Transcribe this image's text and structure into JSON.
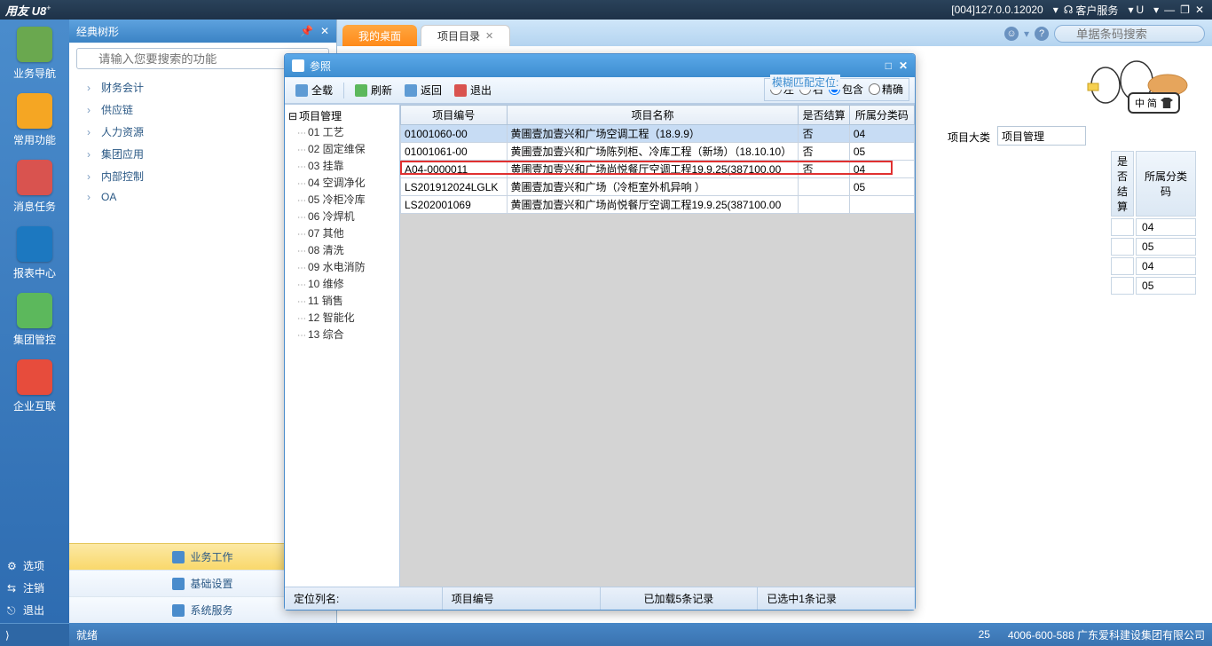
{
  "titlebar": {
    "logo": "用友 U8",
    "sup": "+",
    "server_info": "[004]127.0.0.12020",
    "customer_service": "客户服务",
    "u_label": "U"
  },
  "leftnav": {
    "items": [
      {
        "label": "业务导航",
        "cls": ""
      },
      {
        "label": "常用功能",
        "cls": "orange"
      },
      {
        "label": "消息任务",
        "cls": "red"
      },
      {
        "label": "报表中心",
        "cls": "blue"
      },
      {
        "label": "集团管控",
        "cls": "green2"
      },
      {
        "label": "企业互联",
        "cls": "redpk"
      }
    ],
    "bottom": {
      "options": "选项",
      "logout": "注销",
      "exit": "退出"
    }
  },
  "tree": {
    "title": "经典树形",
    "search_placeholder": "请输入您要搜索的功能",
    "items": [
      "财务会计",
      "供应链",
      "人力资源",
      "集团应用",
      "内部控制",
      "OA"
    ],
    "footer": {
      "biz": "业务工作",
      "basic": "基础设置",
      "sys": "系统服务"
    }
  },
  "tabs": {
    "t1": "我的桌面",
    "t2": "项目目录",
    "search_placeholder": "单据条码搜索"
  },
  "main": {
    "category_label": "项目大类",
    "category_value": "项目管理",
    "doodle_label": "中 简",
    "table": {
      "h1": "是否结算",
      "h2": "所属分类码",
      "rows": [
        "04",
        "05",
        "04",
        "05"
      ]
    }
  },
  "dialog": {
    "title": "参照",
    "toolbar": {
      "full": "全载",
      "refresh": "刷新",
      "back": "返回",
      "exit": "退出"
    },
    "match": {
      "legend": "模糊匹配定位:",
      "left": "左",
      "right": "右",
      "contain": "包含",
      "exact": "精确"
    },
    "tree_root": "项目管理",
    "tree_children": [
      "01 工艺",
      "02 固定维保",
      "03 挂靠",
      "04 空调净化",
      "05 冷柜冷库",
      "06 冷焊机",
      "07 其他",
      "08 清洗",
      "09 水电消防",
      "10 维修",
      "11 销售",
      "12 智能化",
      "13 综合"
    ],
    "grid": {
      "h1": "项目编号",
      "h2": "项目名称",
      "h3": "是否结算",
      "h4": "所属分类码",
      "rows": [
        {
          "c1": "01001060-00",
          "c2": "黄圃壹加壹兴和广场空调工程（18.9.9）",
          "c3": "否",
          "c4": "04"
        },
        {
          "c1": "01001061-00",
          "c2": "黄圃壹加壹兴和广场陈列柜、冷库工程（新场）（18.10.10）",
          "c3": "否",
          "c4": "05"
        },
        {
          "c1": "A04-0000011",
          "c2": "黄圃壹加壹兴和广场尚悦餐厅空调工程19.9.25(387100.00",
          "c3": "否",
          "c4": "04"
        },
        {
          "c1": "LS201912024LGLK",
          "c2": "黄圃壹加壹兴和广场（冷柜室外机异响 ）",
          "c3": "",
          "c4": "05"
        },
        {
          "c1": "LS202001069",
          "c2": "黄圃壹加壹兴和广场尚悦餐厅空调工程19.9.25(387100.00",
          "c3": "",
          "c4": ""
        }
      ]
    },
    "status": {
      "col": "定位列名:",
      "colv": "项目编号",
      "loaded": "已加载5条记录",
      "selected": "已选中1条记录"
    }
  },
  "statusbar": {
    "ready": "就绪",
    "num25": "25",
    "phone": "4006-600-588 广东爱科建设集团有限公司"
  }
}
